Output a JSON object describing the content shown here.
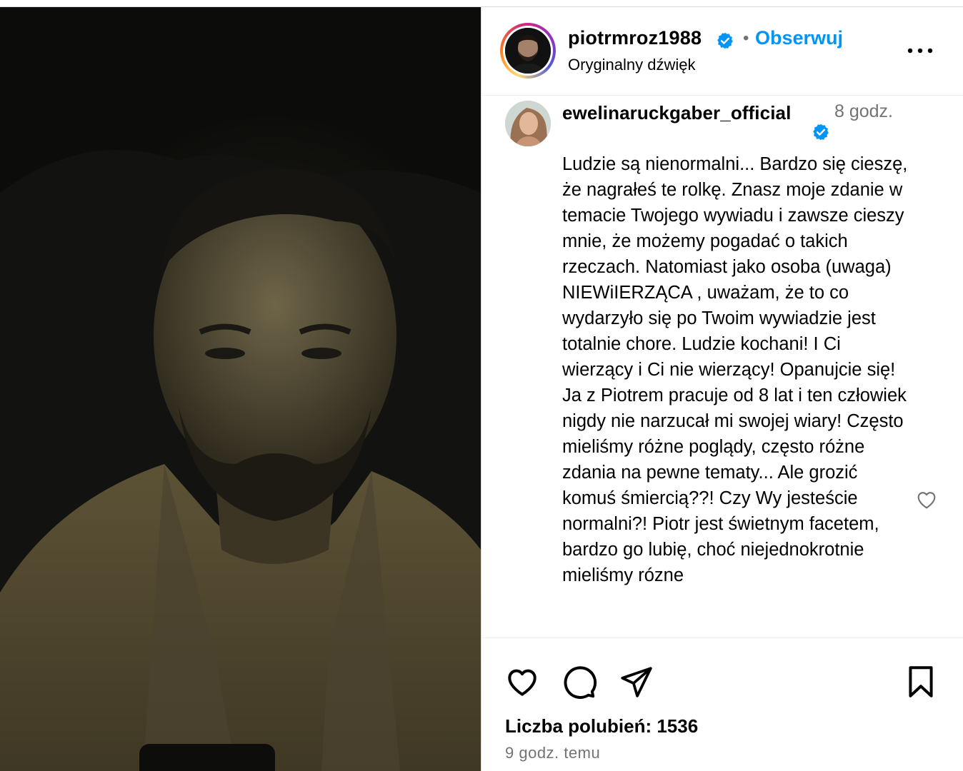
{
  "post": {
    "owner": "piotrmroz1988",
    "separator": "•",
    "follow_label": "Obserwuj",
    "audio_label": "Oryginalny dźwięk",
    "likes_text": "Liczba polubień: 1536",
    "timestamp": "9 godz. temu"
  },
  "comment": {
    "username": "ewelinaruckgaber_official",
    "time": "8 godz.",
    "text": "Ludzie są nienormalni... Bardzo się cieszę, że nagrałeś te rolkę. Znasz moje zdanie w temacie Twojego wywiadu i zawsze cieszy mnie, że możemy pogadać o takich rzeczach. Natomiast jako osoba (uwaga) NIEWiIERZĄCA , uważam, że to co wydarzyło się po Twoim wywiadzie jest totalnie chore. Ludzie kochani! I Ci wierzący i Ci nie wierzący! Opanujcie się! Ja z Piotrem pracuje od 8 lat i ten człowiek nigdy nie narzucał mi swojej wiary! Często mieliśmy różne poglądy, często różne zdania na pewne tematy... Ale grozić komuś śmiercią??! Czy Wy jesteście normalni?! Piotr jest świetnym facetem, bardzo go lubię, choć niejednokrotnie mieliśmy rózne"
  },
  "icons": {
    "verified": "verified-badge-icon",
    "more": "more-options-icon",
    "like": "heart-icon",
    "comment": "comment-bubble-icon",
    "share": "paper-plane-icon",
    "save": "bookmark-icon"
  },
  "colors": {
    "accent": "#0095f6",
    "secondary_text": "#737373",
    "verified": "#0095f6"
  }
}
